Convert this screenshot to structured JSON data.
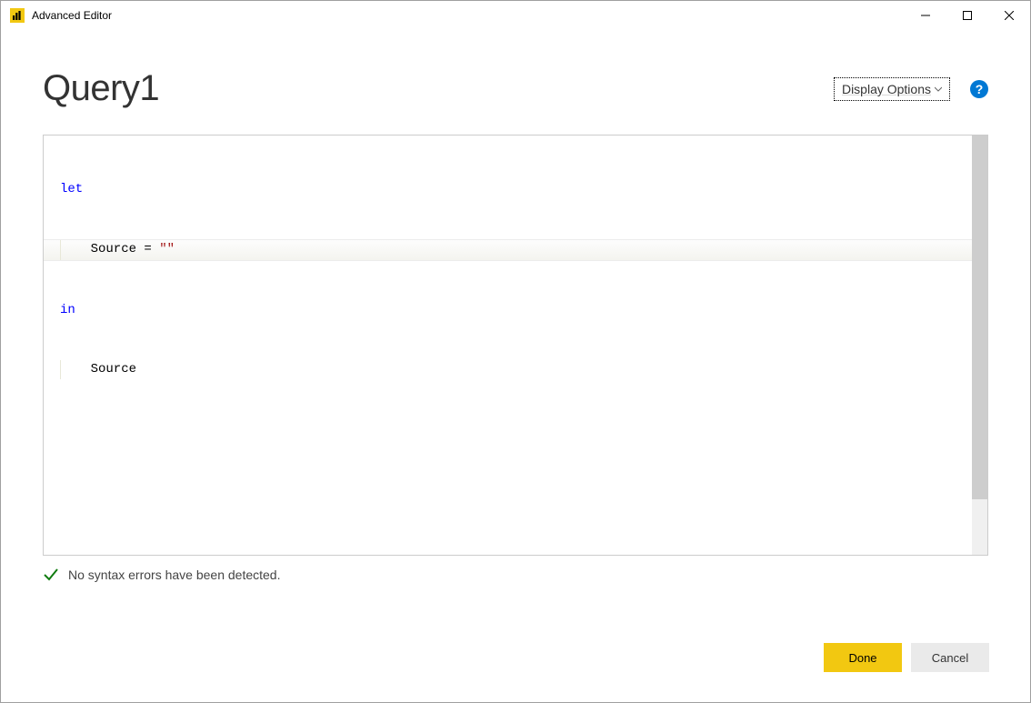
{
  "titlebar": {
    "title": "Advanced Editor"
  },
  "header": {
    "page_title": "Query1",
    "display_options_label": "Display Options"
  },
  "code": {
    "line1_kw": "let",
    "line2_text": "    Source = ",
    "line2_str": "\"\"",
    "line3_kw": "in",
    "line4_text": "    Source"
  },
  "status": {
    "message": "No syntax errors have been detected."
  },
  "buttons": {
    "done": "Done",
    "cancel": "Cancel"
  }
}
